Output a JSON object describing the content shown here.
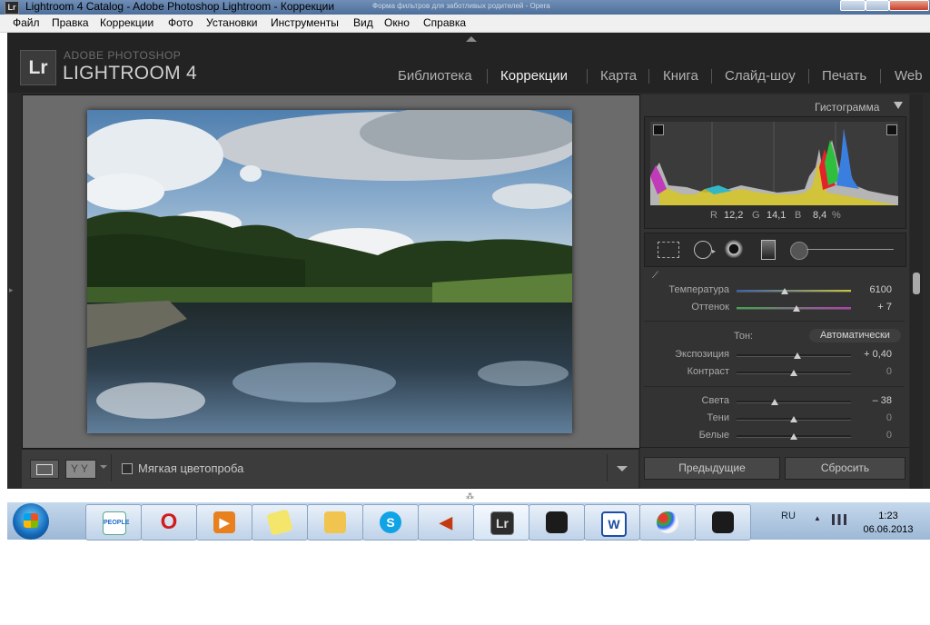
{
  "window": {
    "title": "Lightroom 4 Catalog - Adobe Photoshop Lightroom - Коррекции",
    "app_icon": "Lr",
    "background_title": "Форма фильтров для заботливых родителей - Opera"
  },
  "menu": [
    "Файл",
    "Правка",
    "Коррекции",
    "Фото",
    "Установки",
    "Инструменты",
    "Вид",
    "Окно",
    "Справка"
  ],
  "branding": {
    "logo": "Lr",
    "line1": "ADOBE PHOTOSHOP",
    "line2": "LIGHTROOM 4"
  },
  "modules": [
    {
      "label": "Библиотека",
      "active": false
    },
    {
      "label": "Коррекции",
      "active": true
    },
    {
      "label": "Карта",
      "active": false
    },
    {
      "label": "Книга",
      "active": false
    },
    {
      "label": "Слайд-шоу",
      "active": false
    },
    {
      "label": "Печать",
      "active": false
    },
    {
      "label": "Web",
      "active": false
    }
  ],
  "toolbar": {
    "compare_label": "YY",
    "soft_proof_label": "Мягкая цветопроба",
    "soft_proof_checked": false
  },
  "histogram": {
    "title": "Гистограмма",
    "r_label": "R",
    "r_value": "12,2",
    "g_label": "G",
    "g_value": "14,1",
    "b_label": "B",
    "b_value": "8,4",
    "unit": "%"
  },
  "basic": {
    "temp": {
      "label": "Температура",
      "value": "6100",
      "pos": 0.42
    },
    "tint": {
      "label": "Оттенок",
      "value": "+ 7",
      "pos": 0.52
    },
    "tone_label": "Тон:",
    "auto_label": "Автоматически",
    "exposure": {
      "label": "Экспозиция",
      "value": "+ 0,40",
      "pos": 0.53
    },
    "contrast": {
      "label": "Контраст",
      "value": "0",
      "pos": 0.5
    },
    "highlights": {
      "label": "Света",
      "value": "– 38",
      "pos": 0.33
    },
    "shadows": {
      "label": "Тени",
      "value": "0",
      "pos": 0.5
    },
    "whites": {
      "label": "Белые",
      "value": "0",
      "pos": 0.5
    }
  },
  "panel_buttons": {
    "previous": "Предыдущие",
    "reset": "Сбросить"
  },
  "taskbar": {
    "apps": [
      "people-app-icon",
      "opera-icon",
      "media-player-icon",
      "sticky-notes-icon",
      "explorer-icon",
      "skype-icon",
      "volume-app-icon",
      "lightroom-icon",
      "camera-icon",
      "word-icon",
      "paint-icon",
      "camera2-icon"
    ],
    "lang": "RU",
    "time": "1:23",
    "date": "06.06.2013"
  }
}
